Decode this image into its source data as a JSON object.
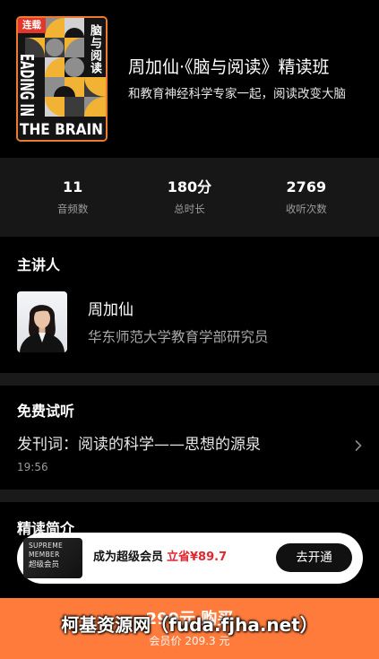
{
  "hero": {
    "cover": {
      "tag": "连载",
      "title_cn": "脑与阅读",
      "title_en_vertical": "EADING IN",
      "title_en_bottom": "THE BRAIN"
    },
    "title": "周加仙·《脑与阅读》精读班",
    "subtitle": "和教育神经科学专家一起，阅读改变大脑"
  },
  "stats": [
    {
      "value": "11",
      "label": "音频数"
    },
    {
      "value": "180分",
      "label": "总时长"
    },
    {
      "value": "2769",
      "label": "收听次数"
    }
  ],
  "lecturer": {
    "heading": "主讲人",
    "name": "周加仙",
    "description": "华东师范大学教育学部研究员"
  },
  "trial": {
    "heading": "免费试听",
    "items": [
      {
        "title": "发刊词：阅读的科学——思想的源泉",
        "duration": "19:56"
      }
    ]
  },
  "intro": {
    "heading": "精读简介"
  },
  "member_banner": {
    "card_line1": "SUPREME",
    "card_line2": "MEMBER",
    "card_line3": "超级会员",
    "text": "成为超级会员",
    "saving": "立省¥89.7",
    "button_label": "去开通"
  },
  "buy_bar": {
    "price_label": "299元 购买",
    "member_price": "会员价 209.3 元"
  },
  "watermark": "柯基资源网（fuda.fjha.net）",
  "colors": {
    "accent": "#ff7b3c",
    "saving": "#e3262f",
    "cover_border": "#ec7a2f",
    "tag": "#e2382c",
    "band": "#1a1a1a"
  },
  "icons": {
    "trial_item_arrow": "chevron-right-icon"
  }
}
